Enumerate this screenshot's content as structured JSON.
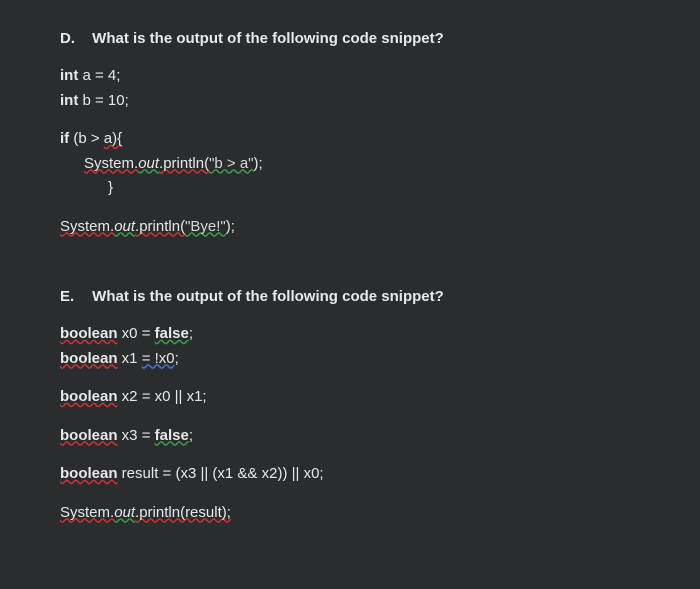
{
  "questions": {
    "D": {
      "label": "D.",
      "prompt": "What is the output of the following code snippet?",
      "code": {
        "l1_kw": "int",
        "l1_rest": " a = 4;",
        "l2_kw": "int",
        "l2_rest": " b = 10;",
        "l3_kw": "if",
        "l3_rest_a": " (b > ",
        "l3_rest_b": "a){",
        "l4_a": "System.",
        "l4_b": "out",
        "l4_c": ".println(",
        "l4_d": "\"b > a\"",
        "l4_e": ");",
        "l5": "}",
        "l6_a": "System.",
        "l6_b": "out",
        "l6_c": ".println(",
        "l6_d": "\"Bye!\"",
        "l6_e": ");"
      }
    },
    "E": {
      "label": "E.",
      "prompt": "What is the output of the following code snippet?",
      "code": {
        "l1_a": "boolean",
        "l1_b": " x0 = ",
        "l1_c": "false",
        "l1_d": ";",
        "l2_a": "boolean",
        "l2_b": " x1 ",
        "l2_c": "= !x0",
        "l2_d": ";",
        "l3_a": "boolean",
        "l3_b": " x2 = x0 || x1;",
        "l4_a": "boolean",
        "l4_b": " x3 = ",
        "l4_c": "false",
        "l4_d": ";",
        "l5_a": "boolean",
        "l5_b": " result = (x3 || (x1 && x2)) || x0;",
        "l6_a": "System.",
        "l6_b": "out",
        "l6_c": ".println(result);"
      }
    }
  }
}
